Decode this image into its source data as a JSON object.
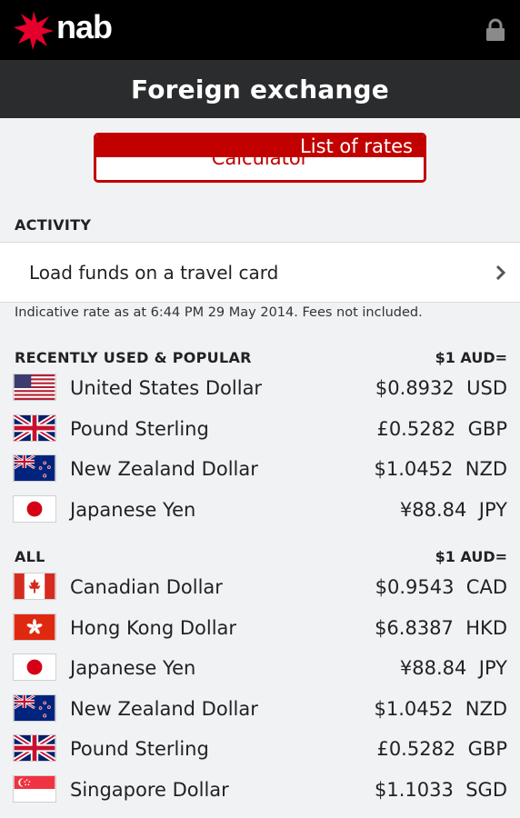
{
  "header": {
    "logo_text": "nab",
    "title": "Foreign exchange"
  },
  "segments": {
    "calculator": "Calculator",
    "list_of_rates": "List of rates"
  },
  "activity": {
    "heading": "ACTIVITY",
    "load_funds": "Load funds on a travel card"
  },
  "indicative_note": "Indicative rate as at 6:44 PM 29 May 2014. Fees not included.",
  "recent": {
    "heading": "RECENTLY USED & POPULAR",
    "unit": "$1 AUD=",
    "items": [
      {
        "name": "United States Dollar",
        "rate": "$0.8932",
        "code": "USD",
        "flag": "us-flag-icon"
      },
      {
        "name": "Pound Sterling",
        "rate": "£0.5282",
        "code": "GBP",
        "flag": "uk-flag-icon"
      },
      {
        "name": "New Zealand Dollar",
        "rate": "$1.0452",
        "code": "NZD",
        "flag": "nz-flag-icon"
      },
      {
        "name": "Japanese Yen",
        "rate": "¥88.84",
        "code": "JPY",
        "flag": "japan-flag-icon"
      }
    ]
  },
  "all": {
    "heading": "ALL",
    "unit": "$1 AUD=",
    "items": [
      {
        "name": "Canadian Dollar",
        "rate": "$0.9543",
        "code": "CAD",
        "flag": "canada-flag-icon"
      },
      {
        "name": "Hong Kong Dollar",
        "rate": "$6.8387",
        "code": "HKD",
        "flag": "hong-kong-flag-icon"
      },
      {
        "name": "Japanese Yen",
        "rate": "¥88.84",
        "code": "JPY",
        "flag": "japan-flag-icon"
      },
      {
        "name": "New Zealand Dollar",
        "rate": "$1.0452",
        "code": "NZD",
        "flag": "nz-flag-icon"
      },
      {
        "name": "Pound Sterling",
        "rate": "£0.5282",
        "code": "GBP",
        "flag": "uk-flag-icon"
      },
      {
        "name": "Singapore Dollar",
        "rate": "$1.1033",
        "code": "SGD",
        "flag": "singapore-flag-icon"
      }
    ]
  },
  "colors": {
    "brand_red": "#c20000",
    "top_bar": "#000000",
    "title_bar": "#2b2c2e",
    "background": "#f1f2f4"
  }
}
